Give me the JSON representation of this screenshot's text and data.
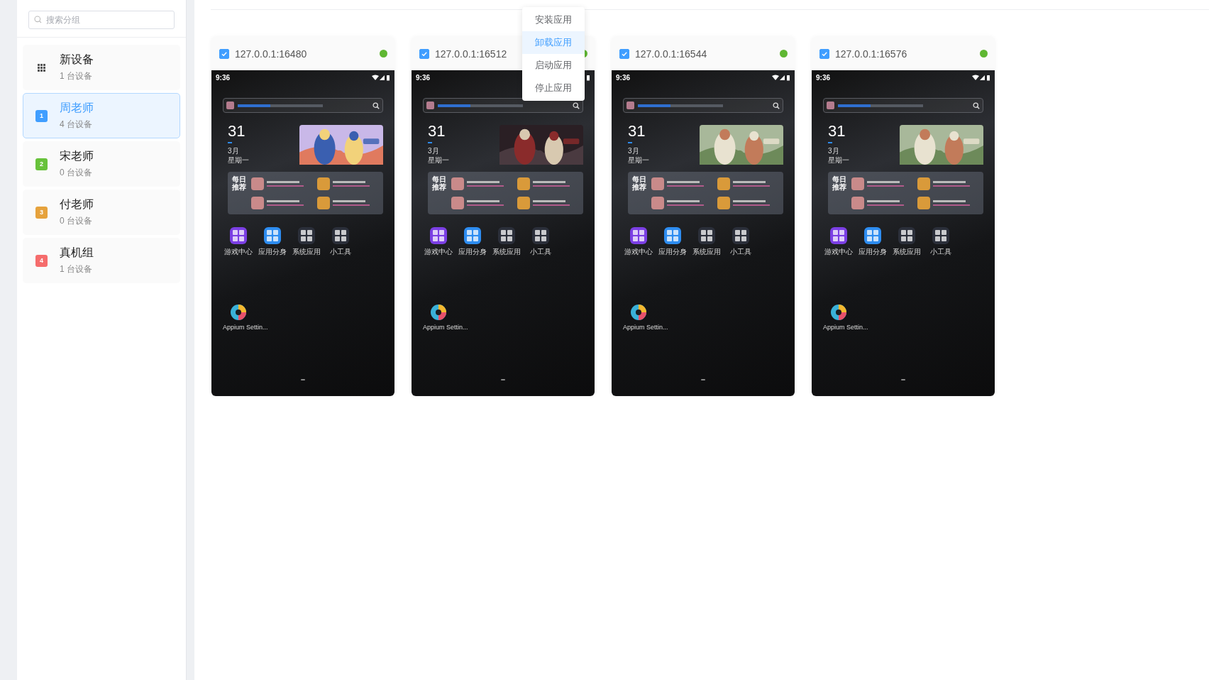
{
  "sidebar": {
    "search": {
      "placeholder": "搜索分组"
    },
    "groups": [
      {
        "kind": "all",
        "name": "新设备",
        "count": "1 台设备",
        "selected": false
      },
      {
        "kind": "numbered",
        "badge": "1",
        "color": "#409eff",
        "name": "周老师",
        "count": "4 台设备",
        "selected": true
      },
      {
        "kind": "numbered",
        "badge": "2",
        "color": "#67c23a",
        "name": "宋老师",
        "count": "0 台设备",
        "selected": false
      },
      {
        "kind": "numbered",
        "badge": "3",
        "color": "#e6a23c",
        "name": "付老师",
        "count": "0 台设备",
        "selected": false
      },
      {
        "kind": "numbered",
        "badge": "4",
        "color": "#f56c6c",
        "name": "真机组",
        "count": "1 台设备",
        "selected": false
      }
    ]
  },
  "devices": [
    {
      "address": "127.0.0.1:16480",
      "checked": true,
      "online": true,
      "screen": {
        "time": "9:36",
        "day": "31",
        "month": "3月",
        "weekday": "星期一",
        "recommend_title": "每日推荐",
        "apps": [
          "游戏中心",
          "应用分身",
          "系统应用",
          "小工具"
        ],
        "shortcut": "Appium Settin..."
      }
    },
    {
      "address": "127.0.0.1:16512",
      "checked": true,
      "online": true,
      "screen": {
        "time": "9:36",
        "day": "31",
        "month": "3月",
        "weekday": "星期一",
        "recommend_title": "每日推荐",
        "apps": [
          "游戏中心",
          "应用分身",
          "系统应用",
          "小工具"
        ],
        "shortcut": "Appium Settin..."
      }
    },
    {
      "address": "127.0.0.1:16544",
      "checked": true,
      "online": true,
      "screen": {
        "time": "9:36",
        "day": "31",
        "month": "3月",
        "weekday": "星期一",
        "recommend_title": "每日推荐",
        "apps": [
          "游戏中心",
          "应用分身",
          "系统应用",
          "小工具"
        ],
        "shortcut": "Appium Settin..."
      }
    },
    {
      "address": "127.0.0.1:16576",
      "checked": true,
      "online": true,
      "screen": {
        "time": "9:36",
        "day": "31",
        "month": "3月",
        "weekday": "星期一",
        "recommend_title": "每日推荐",
        "apps": [
          "游戏中心",
          "应用分身",
          "系统应用",
          "小工具"
        ],
        "shortcut": "Appium Settin..."
      }
    }
  ],
  "app_menu": {
    "items": [
      {
        "label": "安装应用",
        "hovered": false
      },
      {
        "label": "卸载应用",
        "hovered": true
      },
      {
        "label": "启动应用",
        "hovered": false
      },
      {
        "label": "停止应用",
        "hovered": false
      }
    ]
  }
}
